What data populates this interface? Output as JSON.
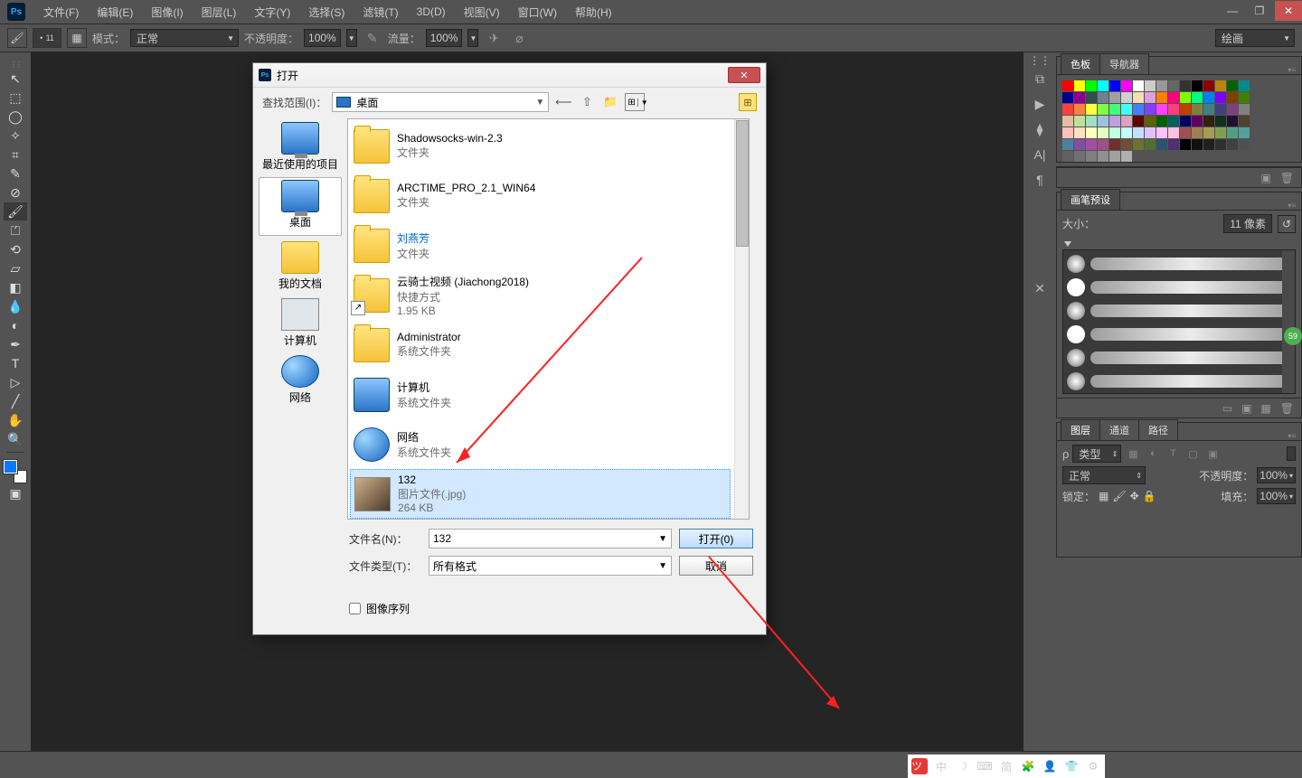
{
  "menubar": {
    "items": [
      "文件(F)",
      "编辑(E)",
      "图像(I)",
      "图层(L)",
      "文字(Y)",
      "选择(S)",
      "滤镜(T)",
      "3D(D)",
      "视图(V)",
      "窗口(W)",
      "帮助(H)"
    ]
  },
  "optionsbar": {
    "brush_size": "11",
    "mode_label": "模式：",
    "mode_value": "正常",
    "opacity_label": "不透明度：",
    "opacity_value": "100%",
    "flow_label": "流量：",
    "flow_value": "100%",
    "right_mode": "绘画"
  },
  "tool_colors": {
    "fg": "#0a78ff"
  },
  "swatches_panel": {
    "tab1": "色板",
    "tab2": "导航器"
  },
  "brushpreset_panel": {
    "tab": "画笔预设",
    "size_label": "大小：",
    "size_value": "11 像素"
  },
  "layers_panel": {
    "tab1": "图层",
    "tab2": "通道",
    "tab3": "路径",
    "kind_label": "类型",
    "blend_value": "正常",
    "opacity_label": "不透明度：",
    "opacity_value": "100%",
    "lock_label": "锁定：",
    "fill_label": "填充：",
    "fill_value": "100%"
  },
  "green_badge": "59",
  "open_dialog": {
    "title": "打开",
    "lookin_label": "查找范围(I)：",
    "lookin_value": "桌面",
    "places": {
      "recent": "最近使用的项目",
      "desktop": "桌面",
      "documents": "我的文档",
      "computer": "计算机",
      "network": "网络"
    },
    "files": [
      {
        "name": "Shadowsocks-win-2.3",
        "sub": "文件夹",
        "type": "folder"
      },
      {
        "name": "ARCTIME_PRO_2.1_WIN64",
        "sub": "文件夹",
        "type": "folder"
      },
      {
        "name": "刘燕芳",
        "sub": "文件夹",
        "type": "folder",
        "link": true
      },
      {
        "name": "云骑士视频 (Jiachong2018)",
        "sub": "快捷方式",
        "sub2": "1.95 KB",
        "type": "shortcut"
      },
      {
        "name": "Administrator",
        "sub": "系统文件夹",
        "type": "folder"
      },
      {
        "name": "计算机",
        "sub": "系统文件夹",
        "type": "monitor"
      },
      {
        "name": "网络",
        "sub": "系统文件夹",
        "type": "globe"
      },
      {
        "name": "132",
        "sub": "图片文件(.jpg)",
        "sub2": "264 KB",
        "type": "thumb",
        "selected": true
      }
    ],
    "filename_label": "文件名(N)：",
    "filename_value": "132",
    "filetype_label": "文件类型(T)：",
    "filetype_value": "所有格式",
    "open_btn": "打开(0)",
    "cancel_btn": "取消",
    "sequence_chk": "图像序列"
  },
  "ime": {
    "label": "中",
    "simp": "简"
  }
}
